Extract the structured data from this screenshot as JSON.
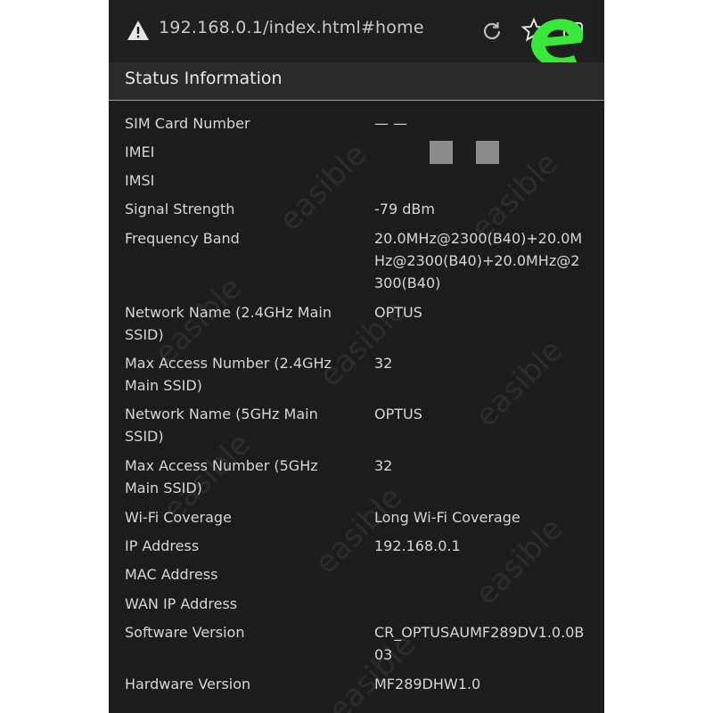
{
  "browser": {
    "url": "192.168.0.1/index.html#home",
    "icons": {
      "security_warning": "warning-triangle-icon",
      "reload": "reload-icon",
      "bookmark": "star-icon",
      "tabs": "tabs-icon"
    },
    "brand_logo_letter": "e",
    "brand_color": "#39e83a"
  },
  "header": {
    "title": "Status Information"
  },
  "rows": [
    {
      "label": "SIM Card Number",
      "value": "— —"
    },
    {
      "label": "IMEI",
      "value": ""
    },
    {
      "label": "IMSI",
      "value": ""
    },
    {
      "label": "Signal Strength",
      "value": "-79 dBm"
    },
    {
      "label": "Frequency Band",
      "value": "20.0MHz@2300(B40)+20.0MHz@2300(B40)+20.0MHz@2300(B40)"
    },
    {
      "label": "Network Name (2.4GHz Main SSID)",
      "value": "OPTUS"
    },
    {
      "label": "Max Access Number (2.4GHz Main SSID)",
      "value": "32"
    },
    {
      "label": "Network Name (5GHz Main SSID)",
      "value": "OPTUS"
    },
    {
      "label": "Max Access Number (5GHz Main SSID)",
      "value": "32"
    },
    {
      "label": "Wi-Fi Coverage",
      "value": "Long Wi-Fi Coverage"
    },
    {
      "label": "IP Address",
      "value": "192.168.0.1"
    },
    {
      "label": "MAC Address",
      "value": ""
    },
    {
      "label": "WAN IP Address",
      "value": ""
    },
    {
      "label": "Software Version",
      "value": "CR_OPTUSAUMF289DV1.0.0B03"
    },
    {
      "label": "Hardware Version",
      "value": "MF289DHW1.0"
    }
  ],
  "watermark_text": "easible",
  "colors": {
    "background": "#1c1c1c",
    "header_bg": "#2a2a2a",
    "text": "#d6d6d6"
  }
}
